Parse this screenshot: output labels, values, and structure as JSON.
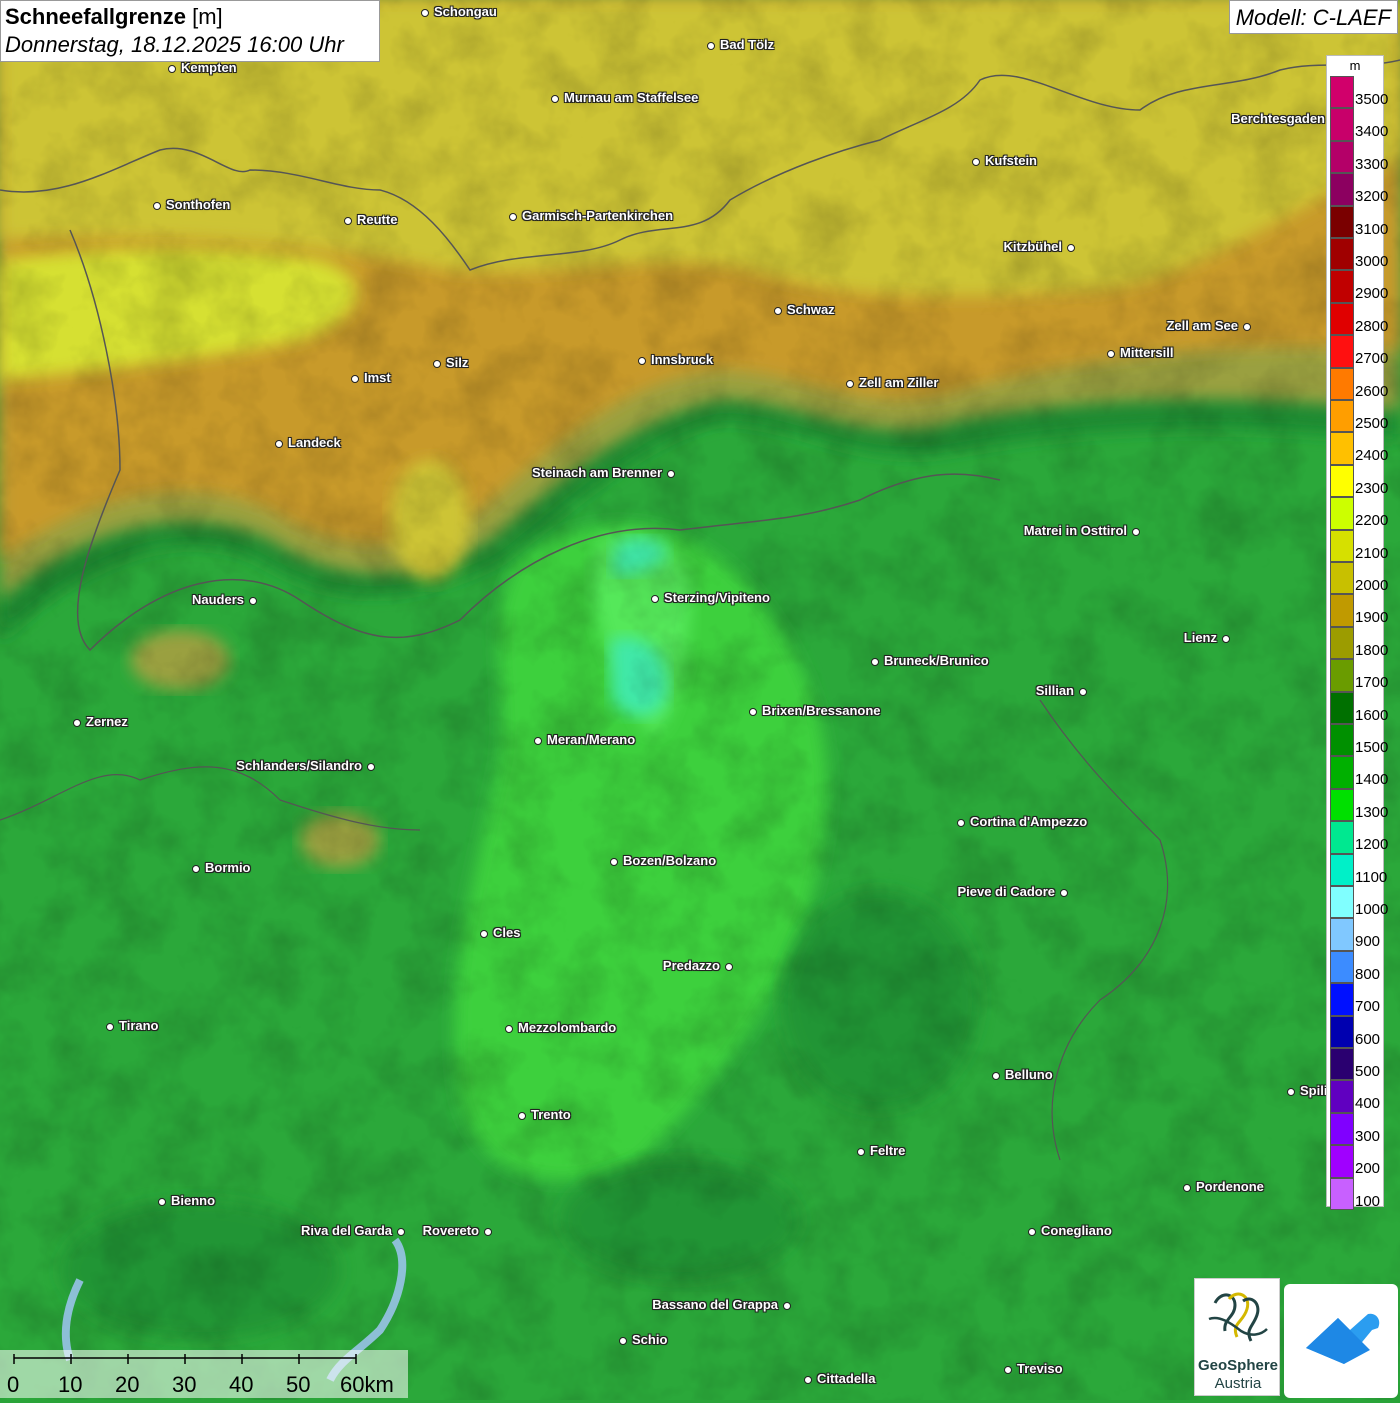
{
  "title": {
    "main": "Schneefallgrenze",
    "unit": "[m]",
    "datetime": "Donnerstag, 18.12.2025 16:00 Uhr"
  },
  "model": "Modell: C-LAEF",
  "legend": {
    "unit": "m",
    "levels": [
      {
        "label": "3500",
        "color": "#d1006b"
      },
      {
        "label": "3400",
        "color": "#c8006a"
      },
      {
        "label": "3300",
        "color": "#b40068"
      },
      {
        "label": "3200",
        "color": "#8c0060"
      },
      {
        "label": "3100",
        "color": "#7a0000"
      },
      {
        "label": "3000",
        "color": "#a00000"
      },
      {
        "label": "2900",
        "color": "#c00000"
      },
      {
        "label": "2800",
        "color": "#e00000"
      },
      {
        "label": "2700",
        "color": "#ff1010"
      },
      {
        "label": "2600",
        "color": "#ff7a00"
      },
      {
        "label": "2500",
        "color": "#ff9e00"
      },
      {
        "label": "2400",
        "color": "#ffc000"
      },
      {
        "label": "2300",
        "color": "#ffff00"
      },
      {
        "label": "2200",
        "color": "#ccff00"
      },
      {
        "label": "2100",
        "color": "#d6e000"
      },
      {
        "label": "2000",
        "color": "#c8c000"
      },
      {
        "label": "1900",
        "color": "#c09a00"
      },
      {
        "label": "1800",
        "color": "#9c9c00"
      },
      {
        "label": "1700",
        "color": "#6a9c00"
      },
      {
        "label": "1600",
        "color": "#007000"
      },
      {
        "label": "1500",
        "color": "#009000"
      },
      {
        "label": "1400",
        "color": "#00b000"
      },
      {
        "label": "1300",
        "color": "#00e000"
      },
      {
        "label": "1200",
        "color": "#00e890"
      },
      {
        "label": "1100",
        "color": "#00f0c8"
      },
      {
        "label": "1000",
        "color": "#80ffff"
      },
      {
        "label": "900",
        "color": "#80c8ff"
      },
      {
        "label": "800",
        "color": "#3c8cff"
      },
      {
        "label": "700",
        "color": "#0010ff"
      },
      {
        "label": "600",
        "color": "#0000b0"
      },
      {
        "label": "500",
        "color": "#2a0070"
      },
      {
        "label": "400",
        "color": "#6000c0"
      },
      {
        "label": "300",
        "color": "#8000ff"
      },
      {
        "label": "200",
        "color": "#a000ff"
      },
      {
        "label": "100",
        "color": "#c860ff"
      }
    ]
  },
  "places": [
    {
      "name": "Schongau"
    },
    {
      "name": "Bad Tölz"
    },
    {
      "name": "Kempten"
    },
    {
      "name": "Murnau am Staffelsee"
    },
    {
      "name": "Berchtesgaden"
    },
    {
      "name": "Kufstein"
    },
    {
      "name": "Sonthofen"
    },
    {
      "name": "Reutte"
    },
    {
      "name": "Garmisch-Partenkirchen"
    },
    {
      "name": "Kitzbühel"
    },
    {
      "name": "Schwaz"
    },
    {
      "name": "Zell am See"
    },
    {
      "name": "Innsbruck"
    },
    {
      "name": "Mittersill"
    },
    {
      "name": "Silz"
    },
    {
      "name": "Imst"
    },
    {
      "name": "Zell am Ziller"
    },
    {
      "name": "Landeck"
    },
    {
      "name": "Steinach am Brenner"
    },
    {
      "name": "Matrei in Osttirol"
    },
    {
      "name": "Nauders"
    },
    {
      "name": "Sterzing/Vipiteno"
    },
    {
      "name": "Lienz"
    },
    {
      "name": "Bruneck/Brunico"
    },
    {
      "name": "Sillian"
    },
    {
      "name": "Zernez"
    },
    {
      "name": "Brixen/Bressanone"
    },
    {
      "name": "Meran/Merano"
    },
    {
      "name": "Schlanders/Silandro"
    },
    {
      "name": "Cortina d'Ampezzo"
    },
    {
      "name": "Bormio"
    },
    {
      "name": "Bozen/Bolzano"
    },
    {
      "name": "Pieve di Cadore"
    },
    {
      "name": "Cles"
    },
    {
      "name": "Predazzo"
    },
    {
      "name": "Tirano"
    },
    {
      "name": "Mezzolombardo"
    },
    {
      "name": "Belluno"
    },
    {
      "name": "Spili"
    },
    {
      "name": "Trento"
    },
    {
      "name": "Feltre"
    },
    {
      "name": "Pordenone"
    },
    {
      "name": "Bienno"
    },
    {
      "name": "Riva del Garda"
    },
    {
      "name": "Rovereto"
    },
    {
      "name": "Conegliano"
    },
    {
      "name": "Bassano del Grappa"
    },
    {
      "name": "Schio"
    },
    {
      "name": "Treviso"
    },
    {
      "name": "Cittadella"
    }
  ],
  "scale": {
    "labels": [
      "0",
      "10",
      "20",
      "30",
      "40",
      "50",
      "60km"
    ]
  },
  "logos": {
    "geosphere_line1": "GeoSphere",
    "geosphere_line2": "Austria"
  }
}
